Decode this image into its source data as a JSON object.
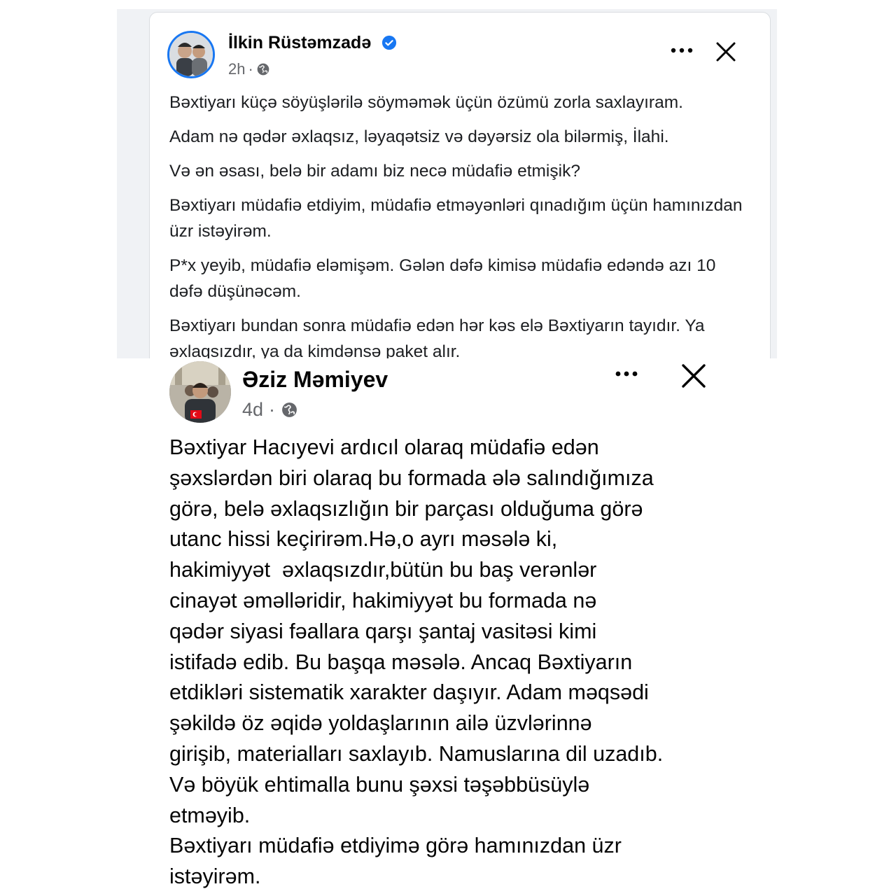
{
  "post1": {
    "author": "İlkin Rüstəmzadə",
    "time": "2h",
    "separator": "·",
    "paragraphs": [
      "Bəxtiyarı küçə söyüşlərilə söyməmək üçün özümü zorla saxlayıram.",
      "Adam nə qədər əxlaqsız, ləyaqətsiz və dəyərsiz ola bilərmiş, İlahi.",
      "Və ən əsası, belə bir adamı biz necə müdafiə etmişik?",
      "Bəxtiyarı müdafiə etdiyim, müdafiə etməyənləri qınadığım üçün hamınızdan üzr istəyirəm.",
      "P*x yeyib, müdafiə eləmişəm. Gələn dəfə kimisə müdafiə edəndə azı 10 dəfə düşünəcəm.",
      "Bəxtiyarı bundan sonra müdafiə edən hər kəs elə Bəxtiyarın tayıdır. Ya əxlaqsızdır, ya da kimdənsə paket alır."
    ]
  },
  "post2": {
    "author": "Əziz Məmiyev",
    "time": "4d",
    "separator": "·",
    "lines": [
      "Bəxtiyar Hacıyevi ardıcıl olaraq müdafiə edən",
      "şəxslərdən biri olaraq bu formada ələ salındığımıza",
      "görə, belə əxlaqsızlığın bir parçası olduğuma görə",
      "utanc hissi keçirirəm.Hə,o ayrı məsələ ki,",
      "hakimiyyət  əxlaqsızdır,bütün bu baş verənlər",
      "cinayət əməlləridir, hakimiyyət bu formada nə",
      "qədər siyasi fəallara qarşı şantaj vasitəsi kimi",
      "istifadə edib. Bu başqa məsələ. Ancaq Bəxtiyarın",
      "etdikləri sistematik xarakter daşıyır. Adam məqsədi",
      "şəkildə öz əqidə yoldaşlarının ailə üzvlərinnə",
      "girişib, materialları saxlayıb. Namuslarına dil uzadıb.",
      "Və böyük ehtimalla bunu şəxsi təşəbbüsüylə",
      "etməyib.",
      "Bəxtiyarı müdafiə etdiyimə görə hamınızdan üzr",
      "istəyirəm."
    ]
  },
  "icons": {
    "more": "more-horizontal-icon",
    "close": "close-icon",
    "audience": "globe-icon",
    "verified": "verified-badge-icon"
  },
  "colors": {
    "verified_blue": "#1877f2",
    "meta_gray": "#65676b",
    "text": "#1c1e21",
    "page_bg": "#f0f2f5"
  }
}
